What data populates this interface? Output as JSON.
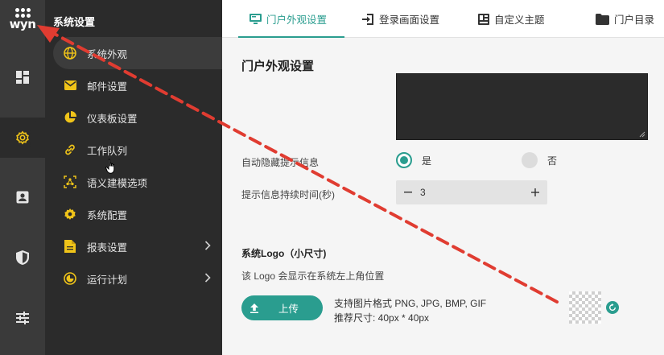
{
  "brand": {
    "logo_text": "wyn"
  },
  "colors": {
    "accent": "#2a9d8f",
    "annotation_arrow": "#e03c31",
    "sidebar_bg": "#2b2b2b",
    "rail_bg": "#3a3a3a"
  },
  "rail": {
    "items": [
      {
        "icon": "dashboard-icon",
        "active": false
      },
      {
        "icon": "gear-icon",
        "active": true
      },
      {
        "icon": "user-card-icon",
        "active": false
      },
      {
        "icon": "shield-icon",
        "active": false
      },
      {
        "icon": "sliders-icon",
        "active": false
      }
    ]
  },
  "menu": {
    "title": "系统设置",
    "items": [
      {
        "label": "系统外观",
        "icon": "globe-icon",
        "active": true
      },
      {
        "label": "邮件设置",
        "icon": "mail-icon"
      },
      {
        "label": "仪表板设置",
        "icon": "pie-chart-icon"
      },
      {
        "label": "工作队列",
        "icon": "link-icon"
      },
      {
        "label": "语义建模选项",
        "icon": "model-icon"
      },
      {
        "label": "系统配置",
        "icon": "gear-icon"
      },
      {
        "label": "报表设置",
        "icon": "document-icon",
        "has_children": true
      },
      {
        "label": "运行计划",
        "icon": "schedule-icon",
        "has_children": true
      }
    ]
  },
  "tabs": [
    {
      "label": "门户外观设置",
      "icon": "monitor-icon",
      "active": true
    },
    {
      "label": "登录画面设置",
      "icon": "login-icon"
    },
    {
      "label": "自定义主题",
      "icon": "theme-icon"
    },
    {
      "label": "门户目录",
      "icon": "folder-icon"
    }
  ],
  "main": {
    "section_title": "门户外观设置",
    "auto_hide": {
      "label": "自动隐藏提示信息",
      "yes": "是",
      "no": "否",
      "selected": "是"
    },
    "duration": {
      "label": "提示信息持续时间(秒)",
      "value": "3",
      "minus": "−",
      "plus": "+"
    },
    "logo": {
      "title": "系统Logo（小尺寸)",
      "description": "该 Logo 会显示在系统左上角位置",
      "upload_label": "上传",
      "formats": "支持图片格式 PNG, JPG, BMP, GIF",
      "size": "推荐尺寸: 40px * 40px"
    }
  }
}
